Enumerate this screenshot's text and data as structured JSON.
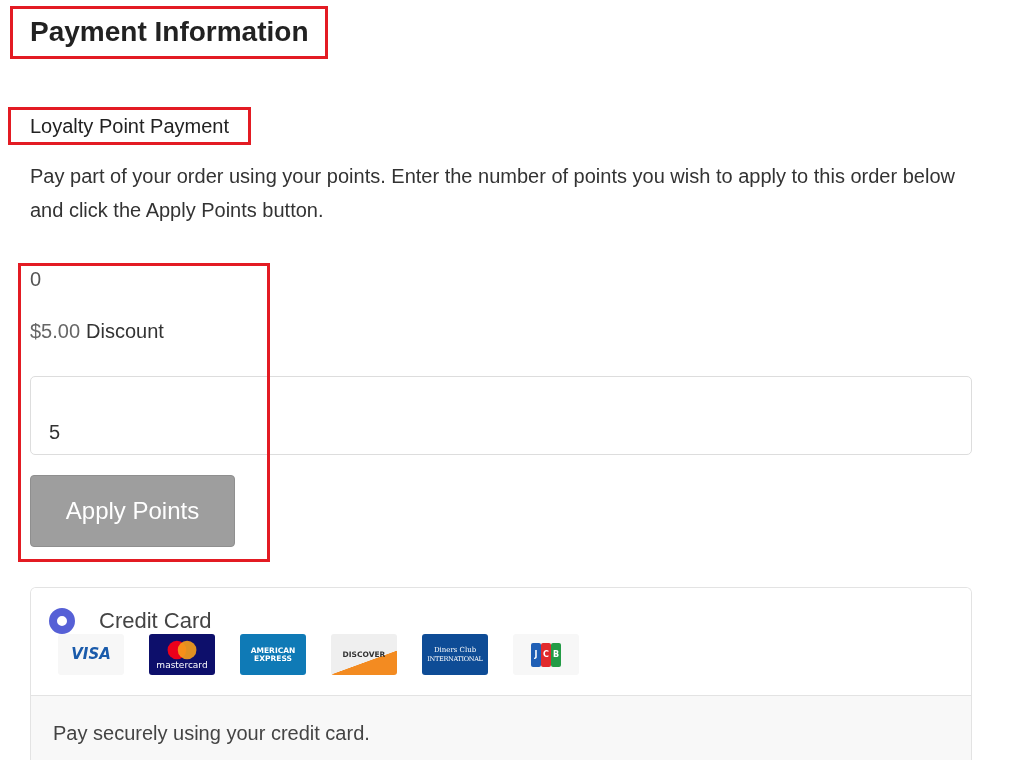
{
  "title": "Payment Information",
  "loyalty": {
    "heading": "Loyalty Point Payment",
    "description": "Pay part of your order using your points. Enter the number of points you wish to apply to this order below and click the Apply Points button.",
    "points": "0",
    "discount_amount": "$5.00",
    "discount_label": "Discount",
    "points_field": {
      "value": "5"
    },
    "button": "Apply Points"
  },
  "payment_methods": [
    {
      "label": "Credit Card",
      "selected": true,
      "description": "Pay securely using your credit card.",
      "cards": [
        {
          "kind": "visa",
          "lines": [
            "VISA"
          ]
        },
        {
          "kind": "mastercard",
          "lines": [
            "mastercard"
          ]
        },
        {
          "kind": "amex",
          "lines": [
            "AMERICAN",
            "EXPRESS"
          ]
        },
        {
          "kind": "discover",
          "lines": [
            "DISCOVER"
          ]
        },
        {
          "kind": "diners",
          "lines": [
            "Diners Club",
            "INTERNATIONAL"
          ]
        },
        {
          "kind": "jcb",
          "lines": [
            "J",
            "C",
            "B"
          ]
        }
      ]
    }
  ]
}
